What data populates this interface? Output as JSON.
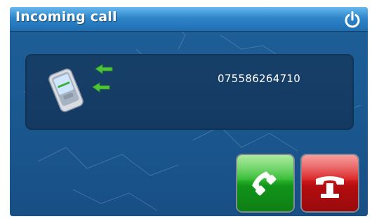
{
  "window": {
    "title": "Incoming call"
  },
  "call": {
    "caller_number": "075586264710"
  },
  "icons": {
    "power": "power-icon",
    "incoming_phone": "incoming-phone-icon",
    "answer": "phone-answer-icon",
    "reject": "phone-hangup-icon"
  },
  "colors": {
    "title_bar": "#2f86c9",
    "background": "#1b5a92",
    "panel": "#153d66",
    "answer_button": "#2fbb2e",
    "reject_button": "#d91d1f",
    "text": "#ffffff"
  }
}
